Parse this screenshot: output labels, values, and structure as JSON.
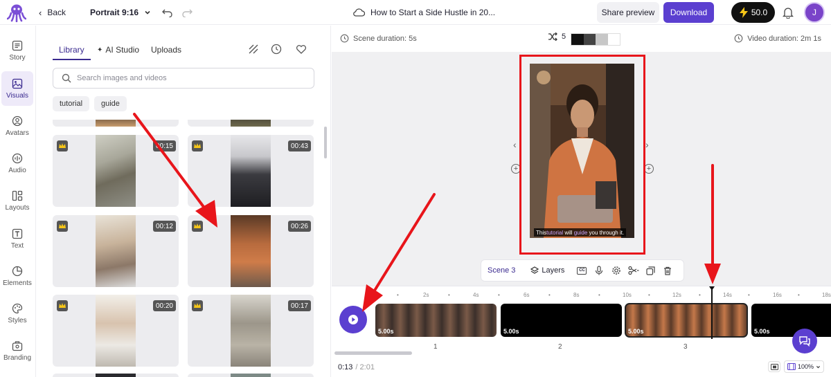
{
  "topbar": {
    "back_label": "Back",
    "aspect_label": "Portrait 9:16",
    "project_title": "How to Start a Side Hustle in 20...",
    "share_label": "Share preview",
    "download_label": "Download",
    "credits": "50.0",
    "avatar_initial": "J"
  },
  "sidenav": {
    "items": [
      {
        "label": "Story",
        "icon": "story-icon"
      },
      {
        "label": "Visuals",
        "icon": "image-icon"
      },
      {
        "label": "Avatars",
        "icon": "avatar-icon"
      },
      {
        "label": "Audio",
        "icon": "audio-icon"
      },
      {
        "label": "Layouts",
        "icon": "layout-icon"
      },
      {
        "label": "Text",
        "icon": "text-icon"
      },
      {
        "label": "Elements",
        "icon": "elements-icon"
      },
      {
        "label": "Styles",
        "icon": "palette-icon"
      },
      {
        "label": "Branding",
        "icon": "branding-icon"
      }
    ],
    "active": "Visuals"
  },
  "library": {
    "tabs": [
      "Library",
      "AI Studio",
      "Uploads"
    ],
    "active_tab": "Library",
    "search_placeholder": "Search images and videos",
    "chips": [
      "tutorial",
      "guide"
    ],
    "cards": [
      {
        "duration": "00:15"
      },
      {
        "duration": "00:43"
      },
      {
        "duration": "00:12"
      },
      {
        "duration": "00:26"
      },
      {
        "duration": "00:20"
      },
      {
        "duration": "00:17"
      }
    ]
  },
  "editor": {
    "scene_duration": "Scene duration: 5s",
    "shuffle_count": "5",
    "video_duration": "Video duration: 2m 1s",
    "caption_parts": [
      "This ",
      "tutorial",
      " will ",
      "guide",
      " you through it."
    ],
    "scene_label": "Scene 3",
    "layers_label": "Layers",
    "cc_label": "CC"
  },
  "timeline": {
    "ticks": [
      "2s",
      "4s",
      "6s",
      "8s",
      "10s",
      "12s",
      "14s",
      "16s",
      "18s"
    ],
    "clips": [
      {
        "number": "1",
        "duration": "5.00s"
      },
      {
        "number": "2",
        "duration": "5.00s"
      },
      {
        "number": "3",
        "duration": "5.00s"
      },
      {
        "number": "",
        "duration": "5.00s"
      }
    ],
    "current_time": "0:13",
    "total_time": "/ 2:01",
    "zoom": "100%"
  },
  "colors": {
    "accent": "#5b3fd0",
    "annotation": "#e8151b"
  }
}
